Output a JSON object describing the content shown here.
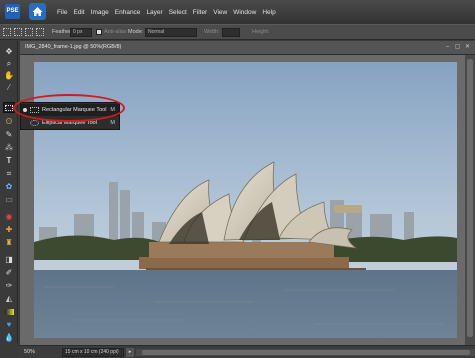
{
  "app": {
    "logo_text": "PSE",
    "colors": {
      "highlight": "#d61820",
      "accent": "#2a6cc4"
    }
  },
  "menu": [
    "File",
    "Edit",
    "Image",
    "Enhance",
    "Layer",
    "Select",
    "Filter",
    "View",
    "Window",
    "Help"
  ],
  "options": {
    "feather_label": "Feather:",
    "feather_value": "0 px",
    "antialias_label": "Anti-alias",
    "mode_label": "Mode:",
    "mode_value": "Normal",
    "width_label": "Width:",
    "height_label": "Height:"
  },
  "document": {
    "title": "IMG_2840_frame-1.jpg @ 50%(RGB/8)"
  },
  "flyout": {
    "items": [
      {
        "label": "Rectangular Marquee Tool",
        "key": "M",
        "icon": "rect-marquee-icon"
      },
      {
        "label": "Elliptical Marquee Tool",
        "key": "M",
        "icon": "ellipse-marquee-icon"
      }
    ]
  },
  "status": {
    "zoom": "50%",
    "doc_size": "15 cm x 10 cm (240 ppi)"
  },
  "tools": [
    "move",
    "zoom",
    "hand",
    "eyedropper",
    "marquee",
    "lasso",
    "quick-selection",
    "magic-wand",
    "type",
    "crop",
    "cookie-cutter",
    "straighten",
    "red-eye",
    "healing",
    "clone-stamp",
    "eraser",
    "brush",
    "smart-brush",
    "paint-bucket",
    "gradient",
    "custom-shape",
    "blur",
    "sponge",
    "pencil",
    "foreground-color",
    "background-color"
  ]
}
